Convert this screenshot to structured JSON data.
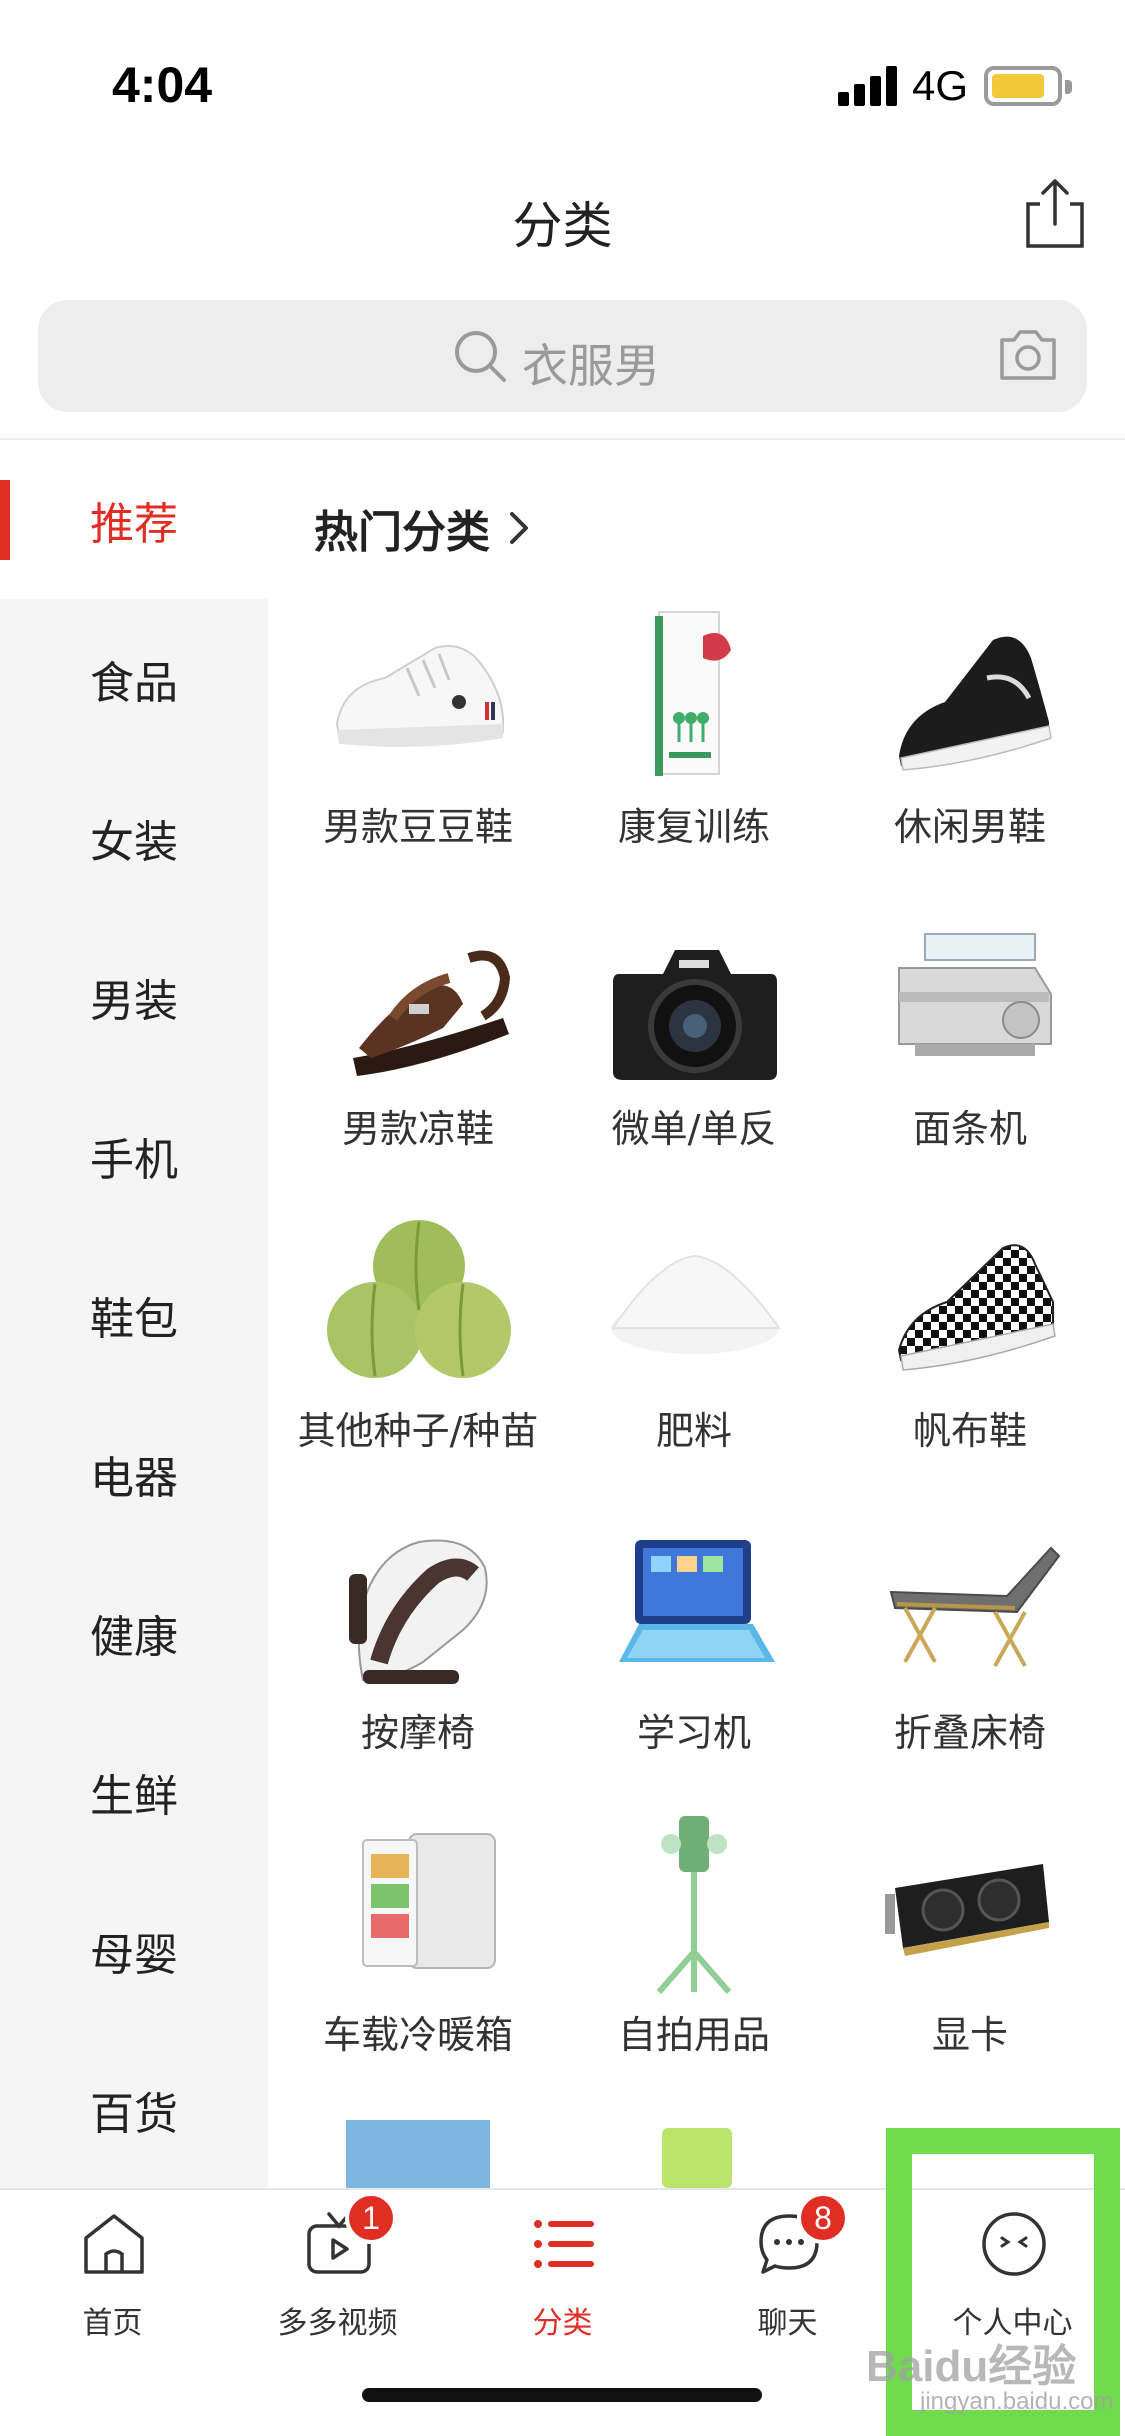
{
  "status_bar": {
    "time": "4:04",
    "network": "4G"
  },
  "nav": {
    "title": "分类"
  },
  "search": {
    "placeholder": "衣服男"
  },
  "sidebar": {
    "items": [
      {
        "label": "推荐"
      },
      {
        "label": "食品"
      },
      {
        "label": "女装"
      },
      {
        "label": "男装"
      },
      {
        "label": "手机"
      },
      {
        "label": "鞋包"
      },
      {
        "label": "电器"
      },
      {
        "label": "健康"
      },
      {
        "label": "生鲜"
      },
      {
        "label": "母婴"
      },
      {
        "label": "百货"
      }
    ]
  },
  "content": {
    "section_title": "热门分类",
    "items": [
      {
        "label": "男款豆豆鞋",
        "icon": "white-sneaker"
      },
      {
        "label": "康复训练",
        "icon": "training-kit-box"
      },
      {
        "label": "休闲男鞋",
        "icon": "black-sneaker"
      },
      {
        "label": "男款凉鞋",
        "icon": "leather-sandal"
      },
      {
        "label": "微单/单反",
        "icon": "dslr-camera"
      },
      {
        "label": "面条机",
        "icon": "noodle-machine"
      },
      {
        "label": "其他种子/种苗",
        "icon": "green-fruit"
      },
      {
        "label": "肥料",
        "icon": "fertilizer-pile"
      },
      {
        "label": "帆布鞋",
        "icon": "checkered-sneaker"
      },
      {
        "label": "按摩椅",
        "icon": "massage-chair"
      },
      {
        "label": "学习机",
        "icon": "learning-tablet"
      },
      {
        "label": "折叠床椅",
        "icon": "folding-bed"
      },
      {
        "label": "车载冷暖箱",
        "icon": "mini-fridge"
      },
      {
        "label": "自拍用品",
        "icon": "selfie-stick"
      },
      {
        "label": "显卡",
        "icon": "graphics-card"
      }
    ]
  },
  "tabs": [
    {
      "label": "首页",
      "icon": "home-icon"
    },
    {
      "label": "多多视频",
      "icon": "video-icon",
      "badge": "1"
    },
    {
      "label": "分类",
      "icon": "category-list-icon"
    },
    {
      "label": "聊天",
      "icon": "chat-icon",
      "badge": "8"
    },
    {
      "label": "个人中心",
      "icon": "profile-icon"
    }
  ],
  "watermark": {
    "text": "Baidu经验",
    "sub": "jingyan.baidu.com"
  },
  "colors": {
    "accent": "#e02e24",
    "sidebar_bg": "#f5f5f5",
    "highlight": "#6fdc4e"
  }
}
